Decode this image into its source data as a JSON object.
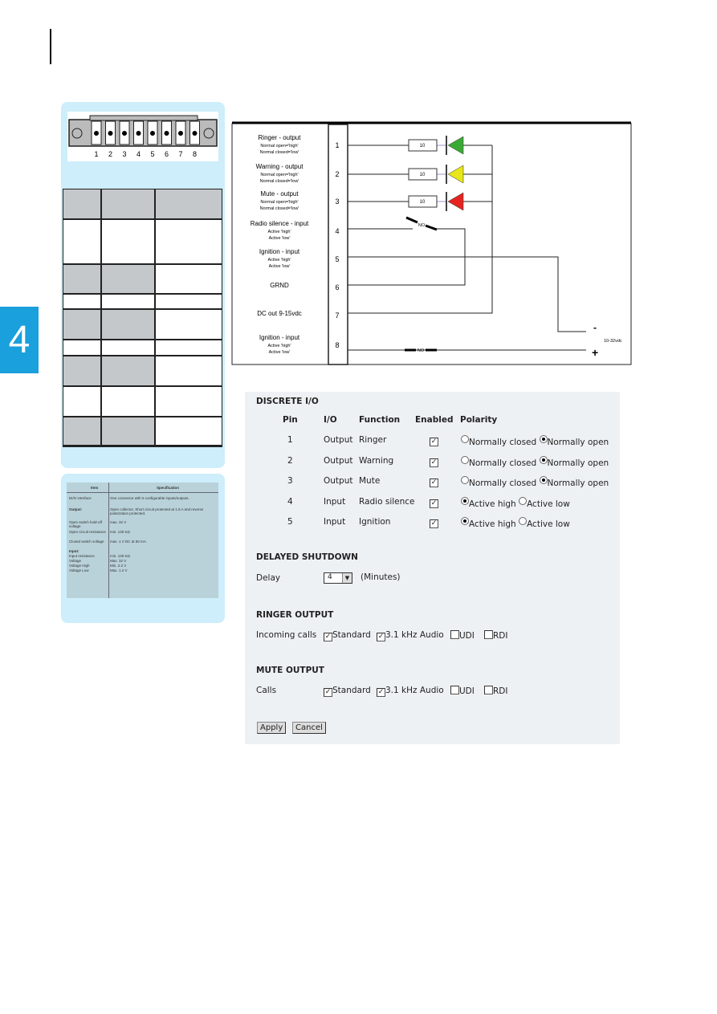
{
  "chapter_tab": "4",
  "connector": {
    "pins": [
      "1",
      "2",
      "3",
      "4",
      "5",
      "6",
      "7",
      "8"
    ]
  },
  "spec_table": {
    "headers": [
      "Item",
      "Specification"
    ],
    "rows": [
      [
        "DI/O interface",
        "One connector with 5 configurable inputs/outputs."
      ],
      [
        "Output:",
        "Open collector, Short circuit protected at 1.5 A and reverse polarization protected."
      ],
      [
        "Open switch hold-off voltage",
        "max. 32 V"
      ],
      [
        "Open circuit resistance",
        "min. 130 KΩ"
      ],
      [
        "Closed switch voltage",
        "max. 1 V DC at 50 mA."
      ],
      [
        "Input:",
        ""
      ],
      [
        "Input resistance",
        "min. 130 KΩ"
      ],
      [
        "Voltage",
        "Max. 32 V"
      ],
      [
        "Voltage High",
        "Min. 2.2 V"
      ],
      [
        "Voltage Low",
        "Max. 1.2 V"
      ]
    ]
  },
  "diagram": {
    "labels": [
      {
        "title": "Ringer - output",
        "sub1": "Normal open='high'",
        "sub2": "Normal closed='low'"
      },
      {
        "title": "Warning - output",
        "sub1": "Normal open='high'",
        "sub2": "Normal closed='low'"
      },
      {
        "title": "Mute - output",
        "sub1": "Normal open='high'",
        "sub2": "Normal closed='low'"
      },
      {
        "title": "Radio silence  - input",
        "sub1": "Active 'high'",
        "sub2": "Active 'low'"
      },
      {
        "title": "Ignition - input",
        "sub1": "Active 'high'",
        "sub2": "Active 'low'"
      },
      {
        "title": "GRND",
        "sub1": "",
        "sub2": ""
      },
      {
        "title": "DC out 9-15vdc",
        "sub1": "",
        "sub2": ""
      },
      {
        "title": "Ignition - input",
        "sub1": "Active 'high'",
        "sub2": "Active 'low'"
      }
    ],
    "pins": [
      "1",
      "2",
      "3",
      "4",
      "5",
      "6",
      "7",
      "8"
    ],
    "resistor": "10",
    "switch": "NO",
    "minus": "-",
    "plus": "+",
    "supply": "10-32vdc",
    "led_colors": [
      "#3aaa35",
      "#e6e619",
      "#e52421"
    ]
  },
  "form": {
    "discrete_title": "DISCRETE I/O",
    "headers": [
      "Pin",
      "I/O",
      "Function",
      "Enabled",
      "Polarity"
    ],
    "rows": [
      {
        "pin": "1",
        "io": "Output",
        "fn": "Ringer",
        "enabled": true,
        "opt1": "Normally closed",
        "opt2": "Normally open",
        "selected": 2
      },
      {
        "pin": "2",
        "io": "Output",
        "fn": "Warning",
        "enabled": true,
        "opt1": "Normally closed",
        "opt2": "Normally open",
        "selected": 2
      },
      {
        "pin": "3",
        "io": "Output",
        "fn": "Mute",
        "enabled": true,
        "opt1": "Normally closed",
        "opt2": "Normally open",
        "selected": 2
      },
      {
        "pin": "4",
        "io": "Input",
        "fn": "Radio silence",
        "enabled": true,
        "opt1": "Active high",
        "opt2": "Active low",
        "selected": 1
      },
      {
        "pin": "5",
        "io": "Input",
        "fn": "Ignition",
        "enabled": true,
        "opt1": "Active high",
        "opt2": "Active low",
        "selected": 1
      }
    ],
    "shutdown_title": "DELAYED SHUTDOWN",
    "delay_label": "Delay",
    "delay_value": "4",
    "delay_unit": "(Minutes)",
    "ringer_title": "RINGER OUTPUT",
    "ringer_label": "Incoming calls",
    "mute_title": "MUTE OUTPUT",
    "mute_label": "Calls",
    "call_types": [
      "Standard",
      "3.1 kHz Audio",
      "UDI",
      "RDI"
    ],
    "ringer_checked": [
      true,
      true,
      false,
      false
    ],
    "mute_checked": [
      true,
      true,
      false,
      false
    ],
    "apply": "Apply",
    "cancel": "Cancel"
  }
}
